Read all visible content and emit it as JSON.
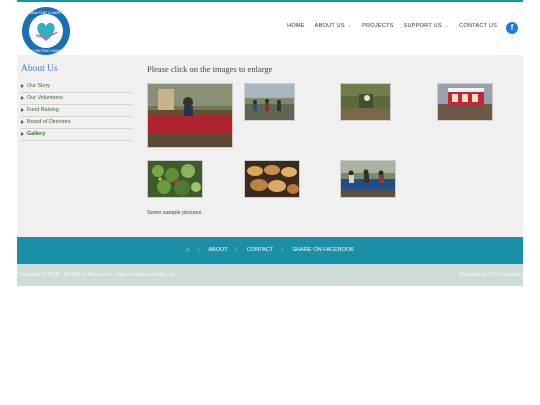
{
  "logo": {
    "top_text": "SANA FOR CHARITY",
    "bottom_text": "A HELPING HAND"
  },
  "nav": {
    "home": "HOME",
    "about": "ABOUT US",
    "projects": "PROJECTS",
    "support": "SUPPORT US",
    "contact": "CONTACT US",
    "facebook": "f"
  },
  "sidebar": {
    "title": "About Us",
    "items": [
      {
        "label": "Our Story"
      },
      {
        "label": "Our Volunteers"
      },
      {
        "label": "Fund Raising"
      },
      {
        "label": "Board of Directors"
      },
      {
        "label": "Gallery"
      }
    ]
  },
  "main": {
    "heading": "Please click on the images to enlarge",
    "caption": "Some sample pictures"
  },
  "footer": {
    "about": "ABOUT",
    "contact": "CONTACT",
    "share": "SHARE ON FACEBOOK"
  },
  "bottom": {
    "copyright": "Copyright © 2018 - All Rights Reserved - www.shaebancharity.org",
    "template": "Template by OS Templates"
  }
}
